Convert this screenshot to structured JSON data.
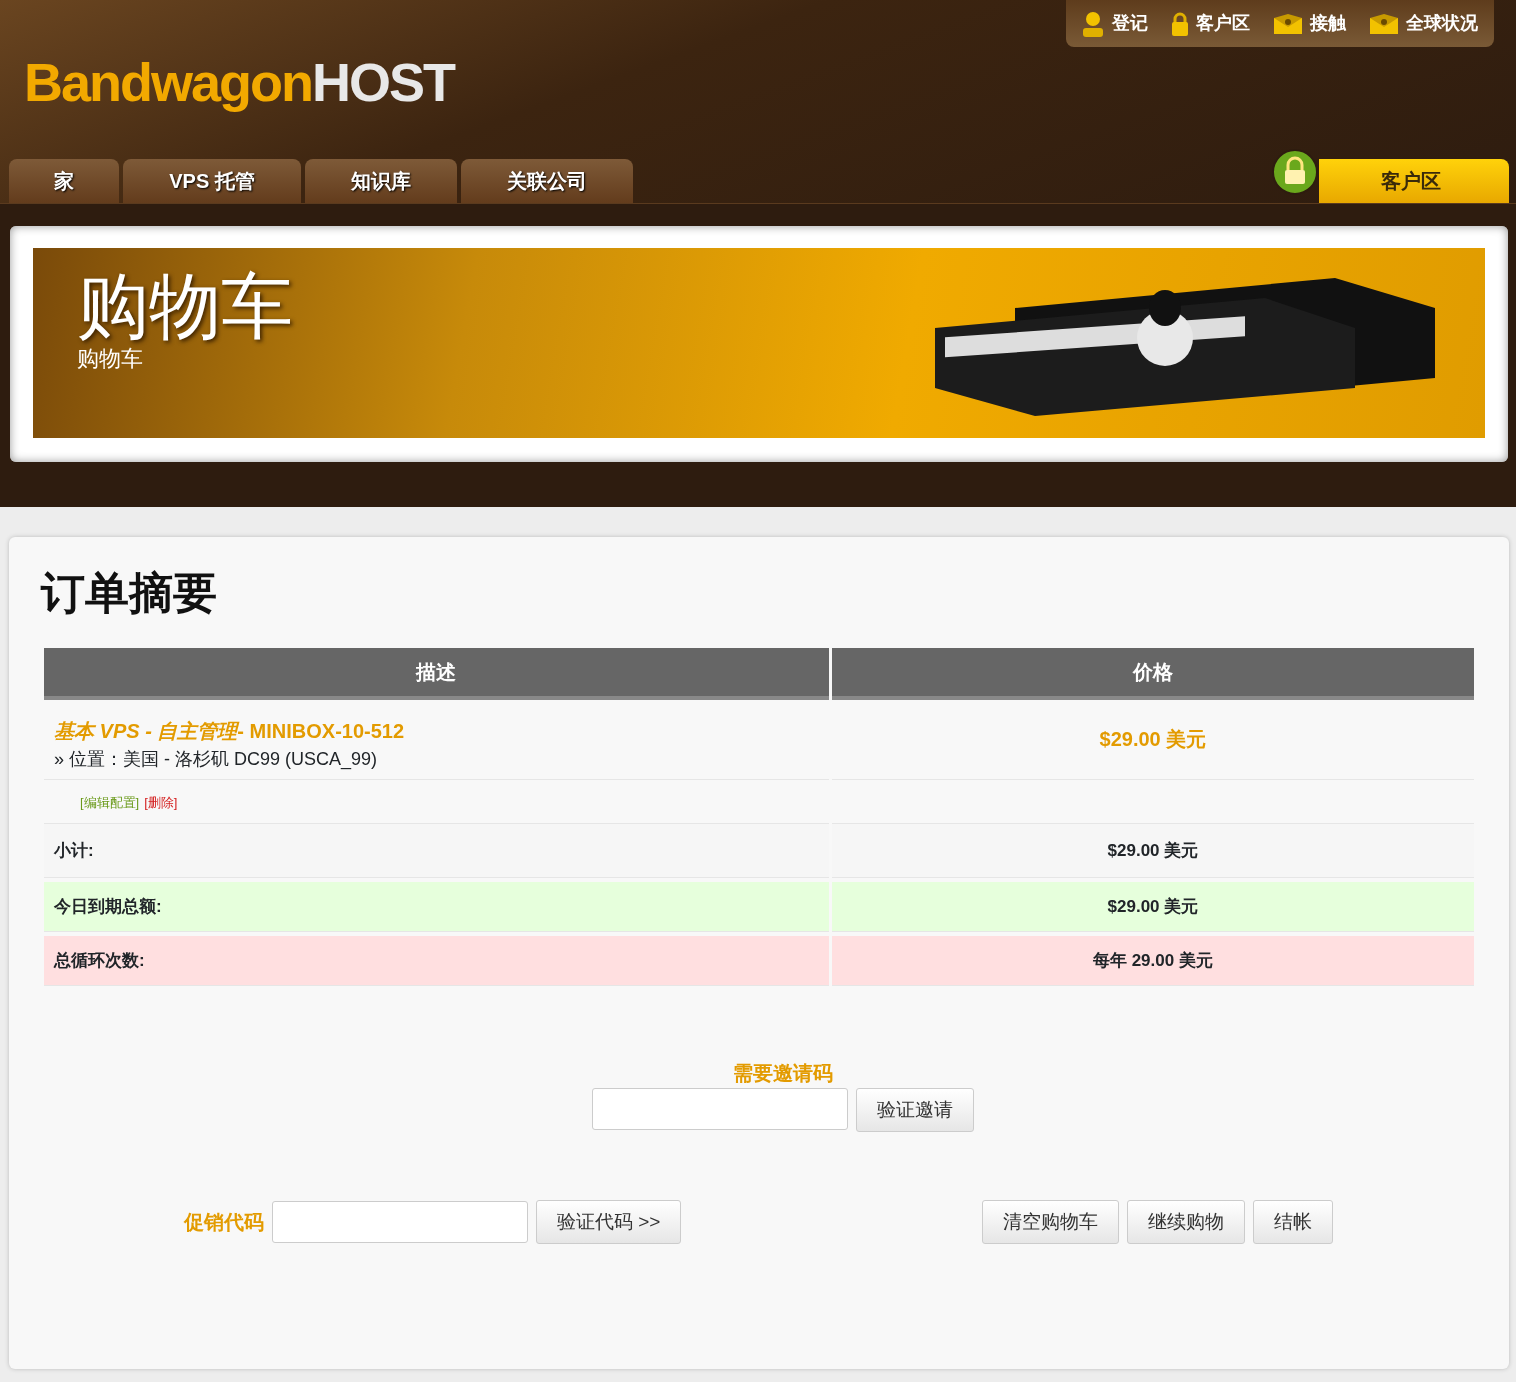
{
  "top_links": [
    {
      "label": "登记",
      "kind": "person"
    },
    {
      "label": "客户区",
      "kind": "lock"
    },
    {
      "label": "接触",
      "kind": "mail"
    },
    {
      "label": "全球状况",
      "kind": "mail"
    }
  ],
  "logo": {
    "part_1": "Bandwagon",
    "part_2": "HOST"
  },
  "nav_tabs": [
    {
      "label": "家"
    },
    {
      "label": "VPS 托管"
    },
    {
      "label": "知识库"
    },
    {
      "label": "关联公司"
    }
  ],
  "client_area_button": {
    "label": "客户区"
  },
  "banner": {
    "title": "购物车",
    "subtitle": "购物车"
  },
  "order_summary": {
    "heading": "订单摘要",
    "columns": [
      "描述",
      "价格"
    ],
    "item": {
      "product": "*基本 VPS - 自主管理*- MINIBOX-10-512",
      "location": "» 位置：美国 - 洛杉矶 DC99 (USCA_99)",
      "price": "$29.00 美元",
      "edit_link": "[编辑配置]",
      "remove_link": "[删除]"
    },
    "totals": [
      {
        "kind": "subtotal",
        "label": "小计:",
        "value": "$29.00 美元"
      },
      {
        "kind": "due_today",
        "label": "今日到期总额:",
        "value": "$29.00 美元"
      },
      {
        "kind": "recurring",
        "label": "总循环次数:",
        "value": "每年 29.00 美元"
      }
    ]
  },
  "invite": {
    "label": "需要邀请码",
    "button": "验证邀请"
  },
  "promo": {
    "label": "促销代码",
    "button": "验证代码 >>"
  },
  "actions": [
    "清空购物车",
    "继续购物",
    "结帐"
  ]
}
